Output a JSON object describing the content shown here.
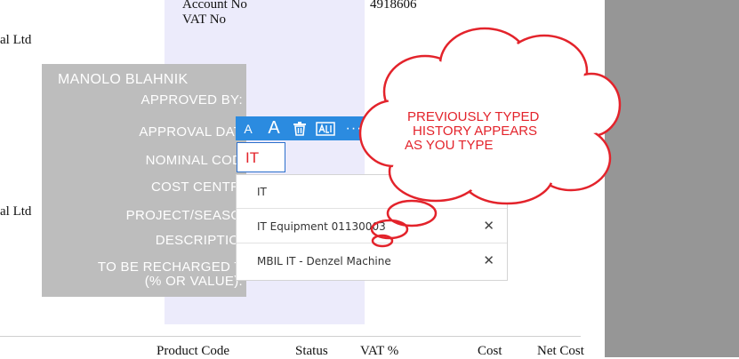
{
  "invoice": {
    "company_line_1": "al Ltd",
    "company_line_2": "al Ltd",
    "account_no_label": "Account No",
    "account_no_value": "4918606",
    "vat_no_label": "VAT No"
  },
  "stamp": {
    "name": "MANOLO BLAHNIK",
    "approved_by": "APPROVED BY:",
    "approval_date": "APPROVAL DATE:",
    "nominal_code": "NOMINAL CODE:",
    "cost_centre": "COST CENTRE:",
    "project_season": "PROJECT/SEASON:",
    "description": "DESCRIPTION:",
    "recharged_1": "TO BE RECHARGED TO:",
    "recharged_2": "(% OR VALUE):"
  },
  "toolbar": {
    "font_small": "A",
    "font_large": "A",
    "more": "···",
    "delete_icon": "trash-icon",
    "text_icon": "text-field-icon"
  },
  "input": {
    "value": "IT"
  },
  "dropdown": {
    "items": [
      {
        "label": "IT"
      },
      {
        "label": "IT Equipment 01130003"
      },
      {
        "label": "MBIL IT - Denzel Machine"
      }
    ],
    "remove_glyph": "✕"
  },
  "callout": {
    "line1": "PREVIOUSLY TYPED",
    "line2": "HISTORY APPEARS",
    "line3": "AS YOU TYPE"
  },
  "table_header": {
    "product_code": "Product Code",
    "status": "Status",
    "vat": "VAT %",
    "cost": "Cost",
    "net_cost": "Net Cost"
  },
  "colors": {
    "accent": "#2b8be0",
    "callout_red": "#e3232b",
    "stamp_gray": "#bdbdbd",
    "panel_gray": "#969696"
  }
}
